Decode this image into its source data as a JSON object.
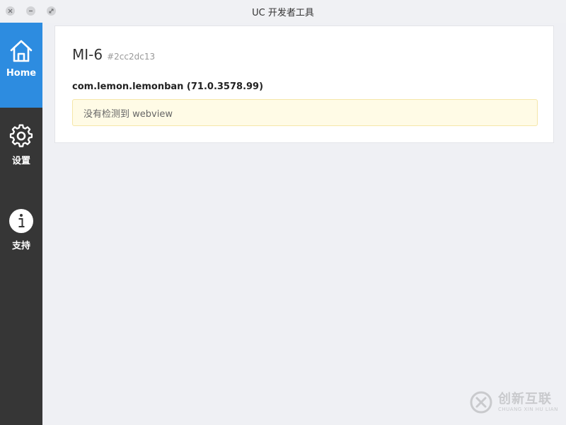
{
  "window": {
    "title": "UC 开发者工具"
  },
  "sidebar": {
    "items": [
      {
        "label": "Home",
        "icon": "home-icon",
        "active": true
      },
      {
        "label": "设置",
        "icon": "gear-icon",
        "active": false
      },
      {
        "label": "支持",
        "icon": "info-icon",
        "active": false
      }
    ]
  },
  "device": {
    "name": "MI-6",
    "id": "#2cc2dc13",
    "package": "com.lemon.lemonban (71.0.3578.99)",
    "alert": "没有检测到 webview"
  },
  "watermark": {
    "main": "创新互联",
    "sub": "CHUANG XIN HU LIAN"
  },
  "colors": {
    "sidebar_bg": "#363636",
    "active_bg": "#2d8ce0",
    "alert_bg": "#fffbe6",
    "alert_border": "#f5e6a8"
  }
}
